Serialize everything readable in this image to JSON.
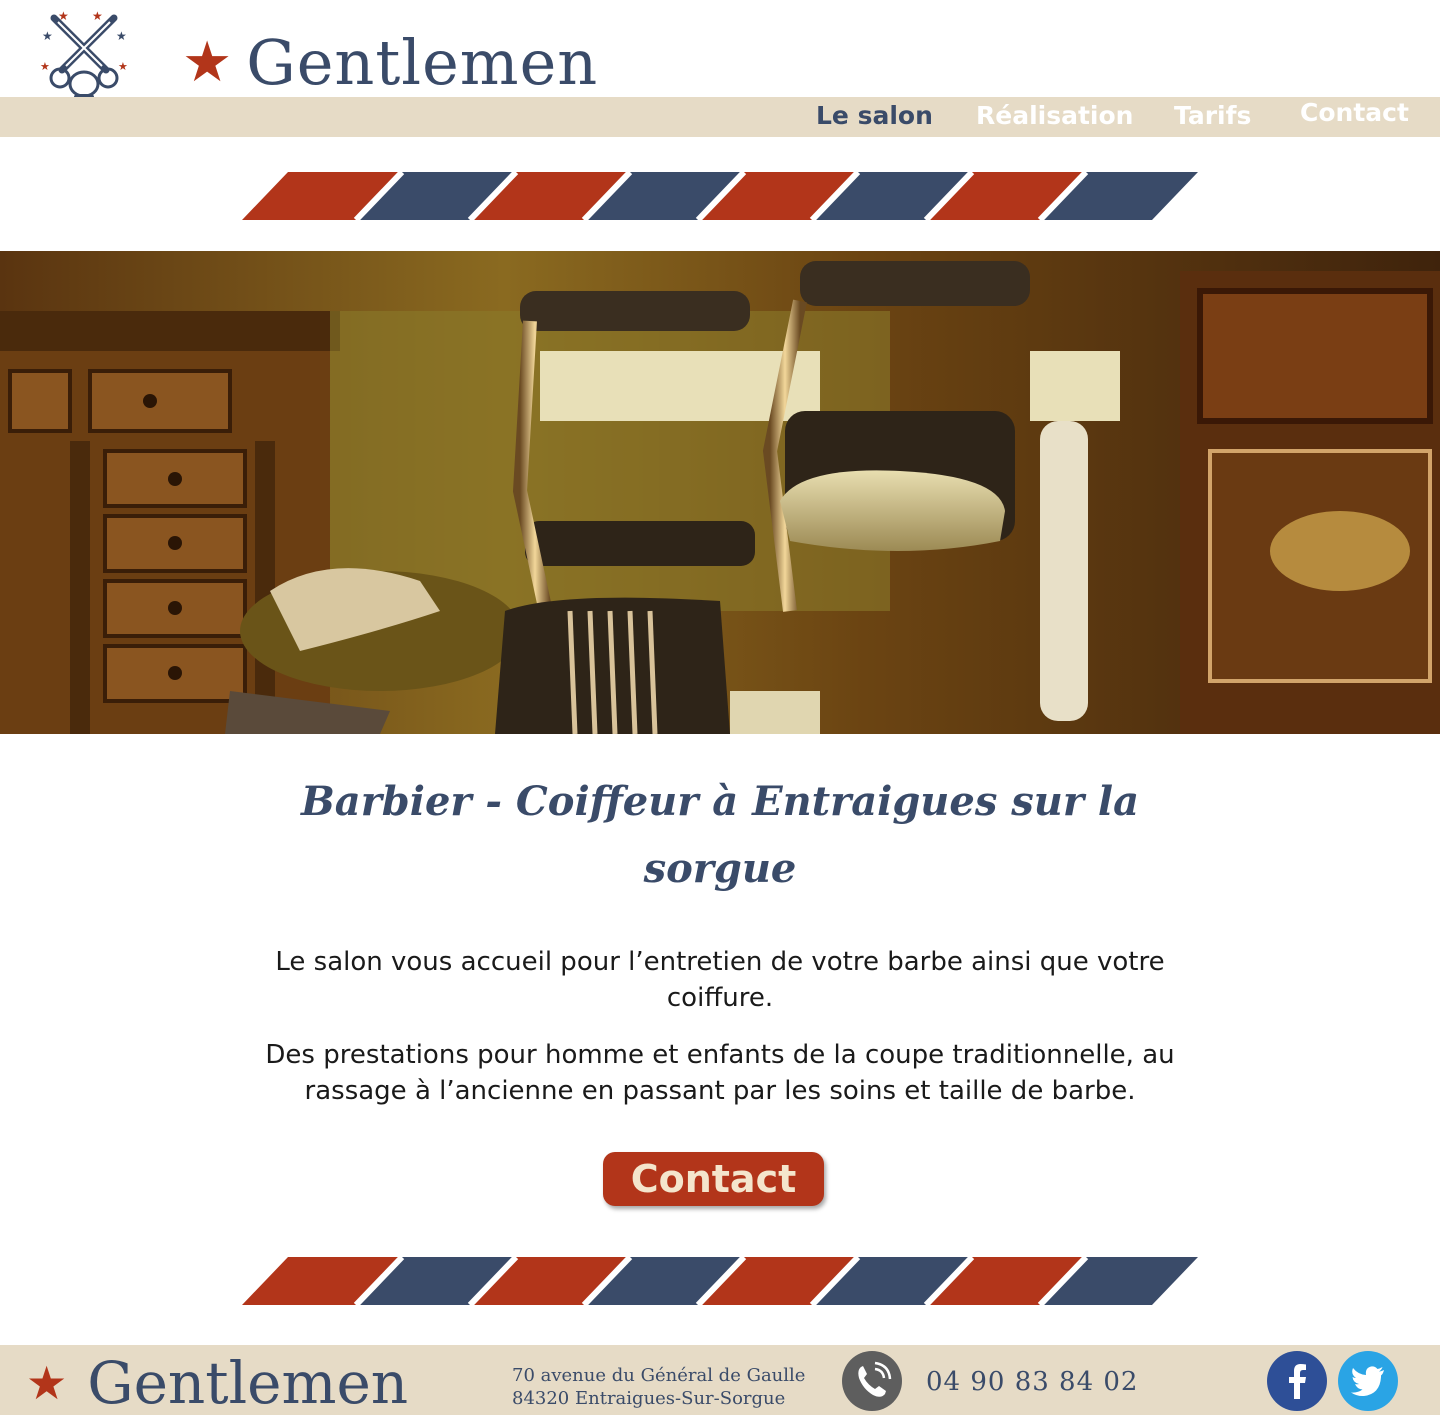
{
  "header": {
    "brand_star": "★",
    "brand_name": "Gentlemen",
    "nav": [
      {
        "label": "Le salon",
        "active": true
      },
      {
        "label": "Réalisation",
        "active": false
      },
      {
        "label": "Tarifs",
        "active": false
      },
      {
        "label": "Contact",
        "active": false
      }
    ]
  },
  "main": {
    "heading": "Barbier - Coiffeur à Entraigues sur la sorgue",
    "paragraph_1": "Le salon vous accueil pour l’entretien de votre barbe ainsi que votre coiffure.",
    "paragraph_2": "Des prestations pour homme et enfants de la coupe traditionnelle,  au rassage à l’ancienne en passant par les soins et taille de barbe.",
    "contact_button": "Contact"
  },
  "footer": {
    "brand_star": "★",
    "brand_name": "Gentlemen",
    "address_line_1": "70 avenue du Général de Gaulle",
    "address_line_2": "84320 Entraigues-Sur-Sorgue",
    "phone": "04 90 83 84 02",
    "phone_icon": "phone-icon",
    "social": [
      "facebook-icon",
      "twitter-icon"
    ]
  },
  "colors": {
    "brand_blue": "#3a4b69",
    "brand_red": "#b2351a",
    "beige": "#e6dbc6",
    "button_text": "#f4e5cc",
    "facebook": "#2e4f97",
    "twitter": "#2aa4e5"
  }
}
